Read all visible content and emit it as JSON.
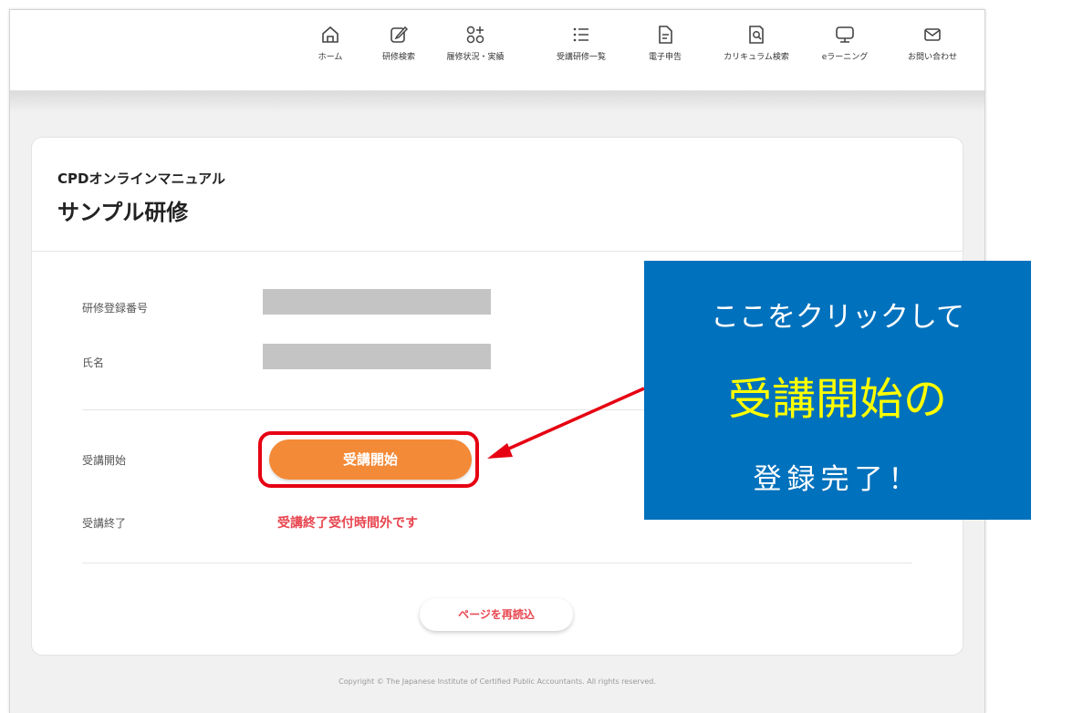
{
  "nav": {
    "items": [
      {
        "label": "ホーム",
        "icon": "home-icon"
      },
      {
        "label": "研修検索",
        "icon": "edit-icon"
      },
      {
        "label": "履修状況・実績",
        "icon": "grid-plus-icon"
      },
      {
        "label": "受講研修一覧",
        "icon": "list-icon"
      },
      {
        "label": "電子申告",
        "icon": "document-icon"
      },
      {
        "label": "カリキュラム検索",
        "icon": "document-search-icon"
      },
      {
        "label": "eラーニング",
        "icon": "monitor-icon"
      },
      {
        "label": "お問い合わせ",
        "icon": "mail-icon"
      }
    ]
  },
  "course": {
    "subtitle": "CPDオンラインマニュアル",
    "title": "サンプル研修"
  },
  "fields": {
    "registration_label": "研修登録番号",
    "name_label": "氏名",
    "start_label": "受講開始",
    "end_label": "受講終了"
  },
  "actions": {
    "start_button": "受講開始",
    "end_message": "受講終了受付時間外です",
    "reload_button": "ページを再読込"
  },
  "footer": {
    "copyright": "Copyright © The Japanese Institute of Certified Public Accountants. All rights reserved."
  },
  "callout": {
    "line1": "ここをクリックして",
    "line2": "受講開始の",
    "line3": "登録完了！"
  },
  "colors": {
    "accent_orange": "#f38a38",
    "highlight_red": "#e60012",
    "callout_blue": "#0071bc",
    "callout_yellow": "#ffff00",
    "message_pink": "#e8454f"
  }
}
